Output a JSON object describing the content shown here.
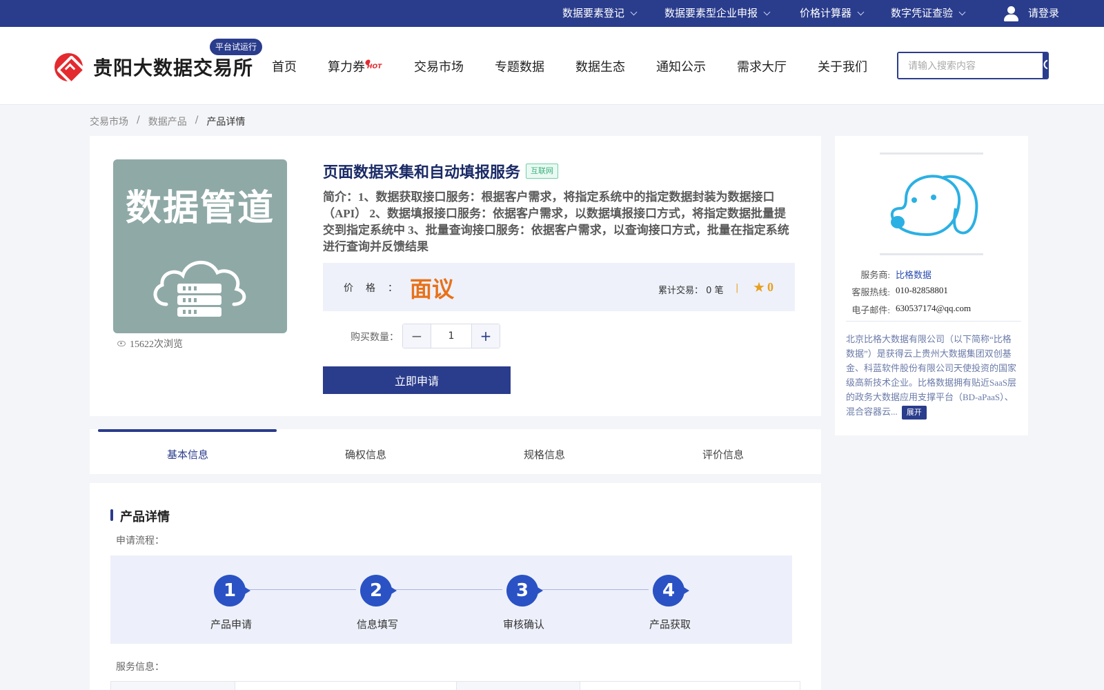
{
  "topbar": {
    "items": [
      {
        "label": "数据要素登记"
      },
      {
        "label": "数据要素型企业申报"
      },
      {
        "label": "价格计算器"
      },
      {
        "label": "数字凭证查验"
      }
    ],
    "login": "请登录"
  },
  "header": {
    "site_name": "贵阳大数据交易所",
    "trial_badge": "平台试运行",
    "nav": [
      "首页",
      "算力券",
      "交易市场",
      "专题数据",
      "数据生态",
      "通知公示",
      "需求大厅",
      "关于我们"
    ],
    "hot_badge": "HOT",
    "search_placeholder": "请输入搜索内容"
  },
  "breadcrumb": [
    "交易市场",
    "/",
    "数据产品",
    "/",
    "产品详情"
  ],
  "product": {
    "image_text": "数据管道",
    "views": "15622次浏览",
    "title": "页面数据采集和自动填报服务",
    "tag": "互联网",
    "intro": "简介：1、数据获取接口服务：根据客户需求，将指定系统中的指定数据封装为数据接口（API） 2、数据填报接口服务：依据客户需求，以数据填报接口方式，将指定数据批量提交到指定系统中 3、批量查询接口服务：依据客户需求，以查询接口方式，批量在指定系统进行查询并反馈结果",
    "price_label": "价格：",
    "price_value": "面议",
    "trade_count": "累计交易：  0 笔",
    "divider": "|",
    "rating": "0",
    "qty_label": "购买数量：",
    "qty_value": "1",
    "minus": "−",
    "plus": "+",
    "apply_label": "立即申请"
  },
  "tabs": [
    "基本信息",
    "确权信息",
    "规格信息",
    "评价信息"
  ],
  "detail": {
    "section_title": "产品详情",
    "flow_label": "申请流程：",
    "steps": [
      {
        "num": "1",
        "label": "产品申请"
      },
      {
        "num": "2",
        "label": "信息填写"
      },
      {
        "num": "3",
        "label": "审核确认"
      },
      {
        "num": "4",
        "label": "产品获取"
      }
    ],
    "service_label": "服务信息："
  },
  "provider": {
    "service_key": "服务商:",
    "service_val": "比格数据",
    "hotline_key": "客服热线:",
    "hotline_val": "010-82858801",
    "email_key": "电子邮件:",
    "email_val": "630537174@qq.com",
    "description": "北京比格大数据有限公司（以下简称“比格数据”）是获得云上贵州大数据集团双创基金、科蓝软件股份有限公司天使投资的国家级高新技术企业。比格数据拥有贴近SaaS层的政务大数据应用支撑平台（BD-aPaaS）、混合容器云...",
    "expand": "展开"
  },
  "colors": {
    "primary": "#2a3c8c",
    "price": "#e8711a",
    "star": "#e8a020",
    "step": "#2a52c4"
  }
}
